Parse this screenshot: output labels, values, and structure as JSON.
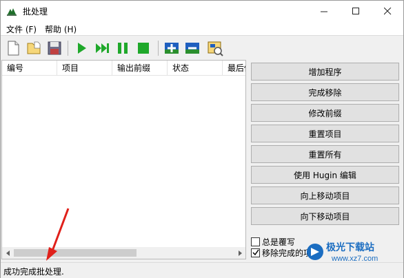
{
  "window": {
    "title": "批处理",
    "app_icon": "hugin-batch-icon",
    "controls": {
      "minimize": "minimize-icon",
      "maximize": "maximize-icon",
      "close": "close-icon"
    }
  },
  "menu": {
    "items": [
      {
        "label": "文件 (F)"
      },
      {
        "label": "帮助 (H)"
      }
    ]
  },
  "toolbar": {
    "icons": [
      "new-file-icon",
      "open-folder-icon",
      "save-disk-icon",
      "run-play-icon",
      "skip-forward-icon",
      "pause-icon",
      "stop-icon",
      "add-plus-icon",
      "remove-minus-icon",
      "edit-project-icon"
    ]
  },
  "list": {
    "columns": [
      {
        "label": "编号"
      },
      {
        "label": "项目"
      },
      {
        "label": "输出前缀"
      },
      {
        "label": "状态"
      },
      {
        "label": "最后修"
      }
    ]
  },
  "buttons": [
    {
      "label": "增加程序"
    },
    {
      "label": "完成移除"
    },
    {
      "label": "修改前缀"
    },
    {
      "label": "重置项目"
    },
    {
      "label": "重置所有"
    },
    {
      "label": "使用 Hugin 编辑"
    },
    {
      "label": "向上移动项目"
    },
    {
      "label": "向下移动项目"
    }
  ],
  "checkboxes": [
    {
      "label": "总是覆写",
      "checked": false
    },
    {
      "label": "移除完成的项目",
      "checked": true
    }
  ],
  "status": {
    "text": "成功完成批处理."
  },
  "watermark": {
    "text": "极光下载站",
    "url_text": "www.xz7.com"
  },
  "colors": {
    "play_green": "#1fa82a",
    "add_blue": "#1f5fbf",
    "arrow_red": "#e0201a",
    "watermark_blue": "#1b6dc1"
  }
}
